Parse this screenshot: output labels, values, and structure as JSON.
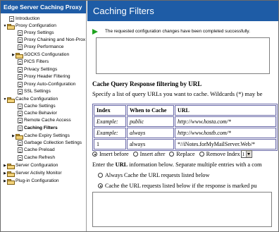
{
  "sidebar": {
    "header": "Edge Server Caching Proxy",
    "items": [
      {
        "label": "Introduction",
        "type": "doc"
      },
      {
        "label": "Proxy Configuration",
        "type": "folder"
      },
      {
        "label": "Proxy Settings",
        "type": "doc"
      },
      {
        "label": "Proxy Chaining and Non-Prox",
        "type": "doc"
      },
      {
        "label": "Proxy Performance",
        "type": "doc"
      },
      {
        "label": "SOCKS Configuration",
        "type": "folder"
      },
      {
        "label": "PICS Filters",
        "type": "doc"
      },
      {
        "label": "Privacy Settings",
        "type": "doc"
      },
      {
        "label": "Proxy Header Filtering",
        "type": "doc"
      },
      {
        "label": "Proxy Auto-Configuration",
        "type": "doc"
      },
      {
        "label": "SSL Settings",
        "type": "doc"
      },
      {
        "label": "Cache Configuration",
        "type": "folder"
      },
      {
        "label": "Cache Settings",
        "type": "doc"
      },
      {
        "label": "Cache Behavior",
        "type": "doc"
      },
      {
        "label": "Remote Cache Access",
        "type": "doc"
      },
      {
        "label": "Caching Filters",
        "type": "doc"
      },
      {
        "label": "Cache Expiry Settings",
        "type": "folder"
      },
      {
        "label": "Garbage Collection Settings",
        "type": "doc"
      },
      {
        "label": "Cache Preload",
        "type": "doc"
      },
      {
        "label": "Cache Refresh",
        "type": "doc"
      },
      {
        "label": "Server Configuration",
        "type": "folder"
      },
      {
        "label": "Server Activity Monitor",
        "type": "folder"
      },
      {
        "label": "Plug-in Configuration",
        "type": "folder"
      }
    ]
  },
  "main": {
    "title": "Caching Filters",
    "status_message": "The requested configuration changes have been completed successfully.",
    "section_heading": "Cache Query Response filtering by URL",
    "description": "Specify a list of query URLs you want to cache. Wildcards (*) may be",
    "table": {
      "headers": [
        "Index",
        "When to Cache",
        "URL"
      ],
      "rows": [
        [
          "Example:",
          "public",
          "http://www.hosta.com/*"
        ],
        [
          "Example:",
          "always",
          "http://www.hostb.com/*"
        ],
        [
          "1",
          "always",
          "*//iNotes.forMyMailServer.Web/*"
        ]
      ]
    },
    "options": {
      "insert_before": "Insert before",
      "insert_after": "Insert after",
      "replace": "Replace",
      "remove_index": "Remove Index",
      "index_value": "1"
    },
    "enter_prefix": "Enter the",
    "enter_bold": "URL",
    "enter_suffix": "information below. Separate multiple entries with a com",
    "radio_always": "Always Cache the URL requests listed below",
    "radio_marked": "Cache the URL requests listed below if the response is marked pu"
  }
}
